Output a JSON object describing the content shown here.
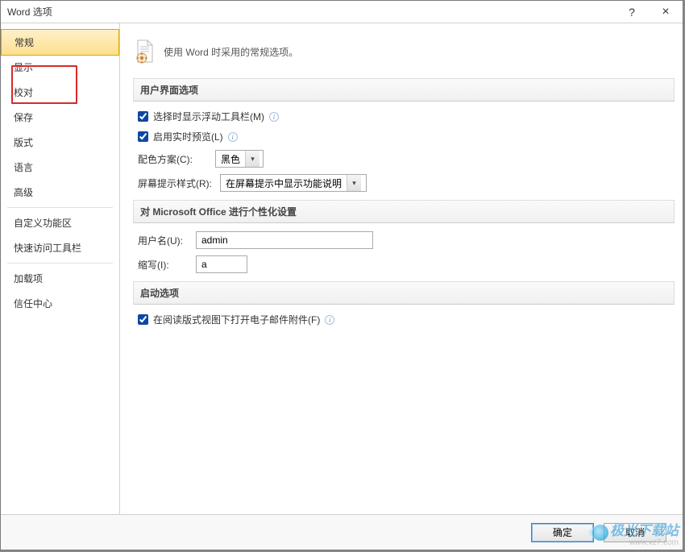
{
  "window": {
    "title": "Word 选项",
    "help_label": "?",
    "close_label": "×"
  },
  "sidebar": {
    "items": [
      {
        "label": "常规",
        "selected": true
      },
      {
        "label": "显示"
      },
      {
        "label": "校对"
      },
      {
        "label": "保存"
      },
      {
        "label": "版式"
      },
      {
        "label": "语言"
      },
      {
        "label": "高级"
      }
    ],
    "items2": [
      {
        "label": "自定义功能区"
      },
      {
        "label": "快速访问工具栏"
      }
    ],
    "items3": [
      {
        "label": "加载项"
      },
      {
        "label": "信任中心"
      }
    ]
  },
  "intro": {
    "text": "使用 Word 时采用的常规选项。"
  },
  "sections": {
    "ui": {
      "header": "用户界面选项",
      "check_floating_label": "选择时显示浮动工具栏(M)",
      "check_floating_checked": true,
      "check_preview_label": "启用实时预览(L)",
      "check_preview_checked": true,
      "color_scheme_label": "配色方案(C):",
      "color_scheme_value": "黑色",
      "tooltip_style_label": "屏幕提示样式(R):",
      "tooltip_style_value": "在屏幕提示中显示功能说明"
    },
    "office": {
      "header": "对 Microsoft Office 进行个性化设置",
      "username_label": "用户名(U):",
      "username_value": "admin",
      "initials_label": "缩写(I):",
      "initials_value": "a"
    },
    "startup": {
      "header": "启动选项",
      "check_reading_label": "在阅读版式视图下打开电子邮件附件(F)",
      "check_reading_checked": true
    }
  },
  "footer": {
    "ok_label": "确定",
    "cancel_label": "取消"
  },
  "watermark": {
    "main": "极光下载站",
    "sub": "www.xz7.com"
  }
}
